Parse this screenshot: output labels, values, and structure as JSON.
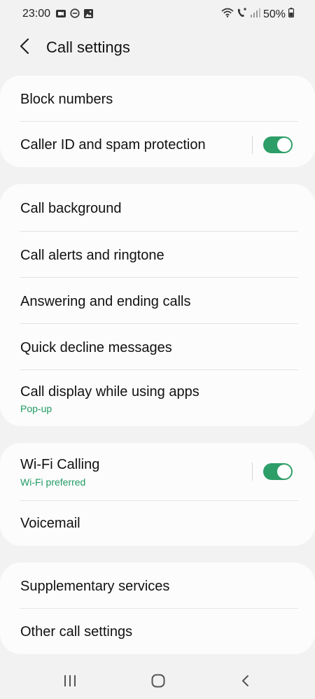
{
  "status_bar": {
    "time": "23:00",
    "battery_percent": "50%"
  },
  "header": {
    "title": "Call settings"
  },
  "colors": {
    "accent": "#1f9b62",
    "toggle_on": "#2e9e68",
    "background": "#f2f2f2",
    "card": "#fcfcfc"
  },
  "sections": [
    {
      "items": [
        {
          "title": "Block numbers"
        },
        {
          "title": "Caller ID and spam protection",
          "toggle": true
        }
      ]
    },
    {
      "items": [
        {
          "title": "Call background"
        },
        {
          "title": "Call alerts and ringtone"
        },
        {
          "title": "Answering and ending calls"
        },
        {
          "title": "Quick decline messages"
        },
        {
          "title": "Call display while using apps",
          "subtitle": "Pop-up"
        }
      ]
    },
    {
      "items": [
        {
          "title": "Wi-Fi Calling",
          "subtitle": "Wi-Fi preferred",
          "toggle": true
        },
        {
          "title": "Voicemail"
        }
      ]
    },
    {
      "items": [
        {
          "title": "Supplementary services"
        },
        {
          "title": "Other call settings"
        }
      ]
    }
  ],
  "nav_bar": {
    "icons": [
      "recent-apps-icon",
      "home-icon",
      "back-icon"
    ]
  }
}
